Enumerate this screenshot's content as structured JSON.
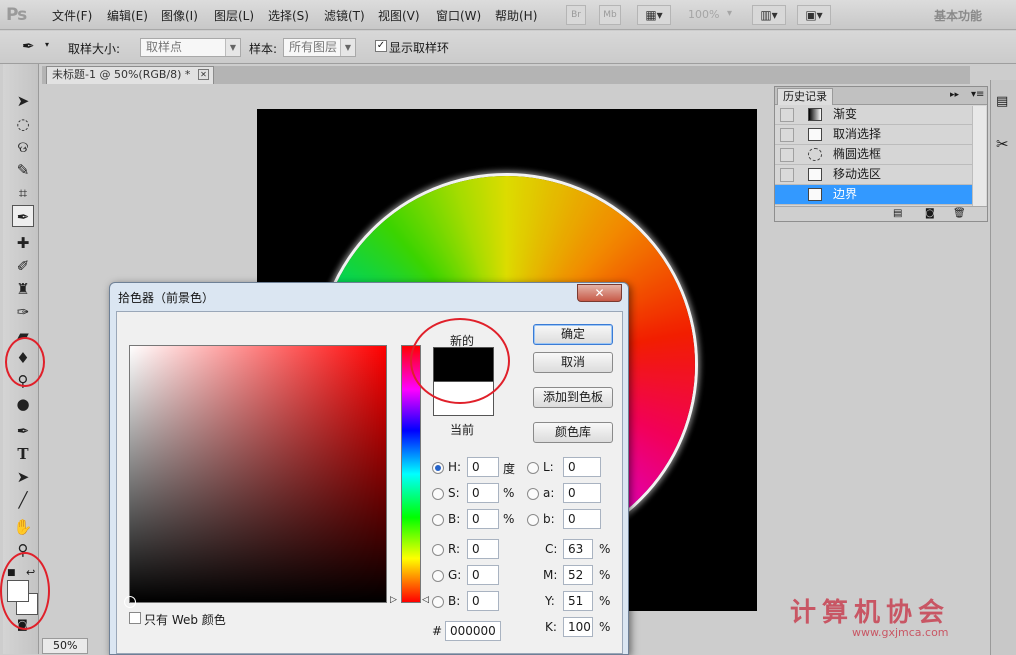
{
  "app": {
    "logo": "Ps"
  },
  "menu": [
    "文件(F)",
    "编辑(E)",
    "图像(I)",
    "图层(L)",
    "选择(S)",
    "滤镜(T)",
    "视图(V)",
    "窗口(W)",
    "帮助(H)"
  ],
  "menubar_buttons": {
    "br": "Br",
    "mb": "Mb",
    "zoom": "100%",
    "workspace": "基本功能"
  },
  "options": {
    "sample_size_label": "取样大小:",
    "sample_size_value": "取样点",
    "sample_label": "样本:",
    "sample_value": "所有图层",
    "show_ring_label": "显示取样环",
    "show_ring_checked": true
  },
  "document_tab": {
    "title": "未标题-1 @ 50%(RGB/8) *",
    "close": "✕"
  },
  "history_panel": {
    "tab": "历史记录",
    "items": [
      {
        "label": "渐变",
        "selected": false
      },
      {
        "label": "取消选择",
        "selected": false
      },
      {
        "label": "椭圆选框",
        "selected": false
      },
      {
        "label": "移动选区",
        "selected": false
      },
      {
        "label": "边界",
        "selected": true
      }
    ]
  },
  "status": {
    "zoom": "50%"
  },
  "color_picker": {
    "title": "拾色器（前景色）",
    "new_label": "新的",
    "current_label": "当前",
    "new_color": "#000000",
    "current_color": "#ffffff",
    "buttons": {
      "ok": "确定",
      "cancel": "取消",
      "add_to_swatches": "添加到色板",
      "color_libraries": "颜色库"
    },
    "web_only_label": "只有 Web 颜色",
    "hsb": {
      "H": "0",
      "S": "0",
      "B": "0"
    },
    "lab": {
      "L": "0",
      "a": "0",
      "b": "0"
    },
    "rgb": {
      "R": "0",
      "G": "0",
      "B": "0"
    },
    "cmyk": {
      "C": "63",
      "M": "52",
      "Y": "51",
      "K": "100"
    },
    "units": {
      "degree": "度",
      "percent": "%"
    },
    "hex_label": "#",
    "hex": "000000"
  },
  "watermark": {
    "text": "计算机协会",
    "url": "www.gxjmca.com"
  }
}
